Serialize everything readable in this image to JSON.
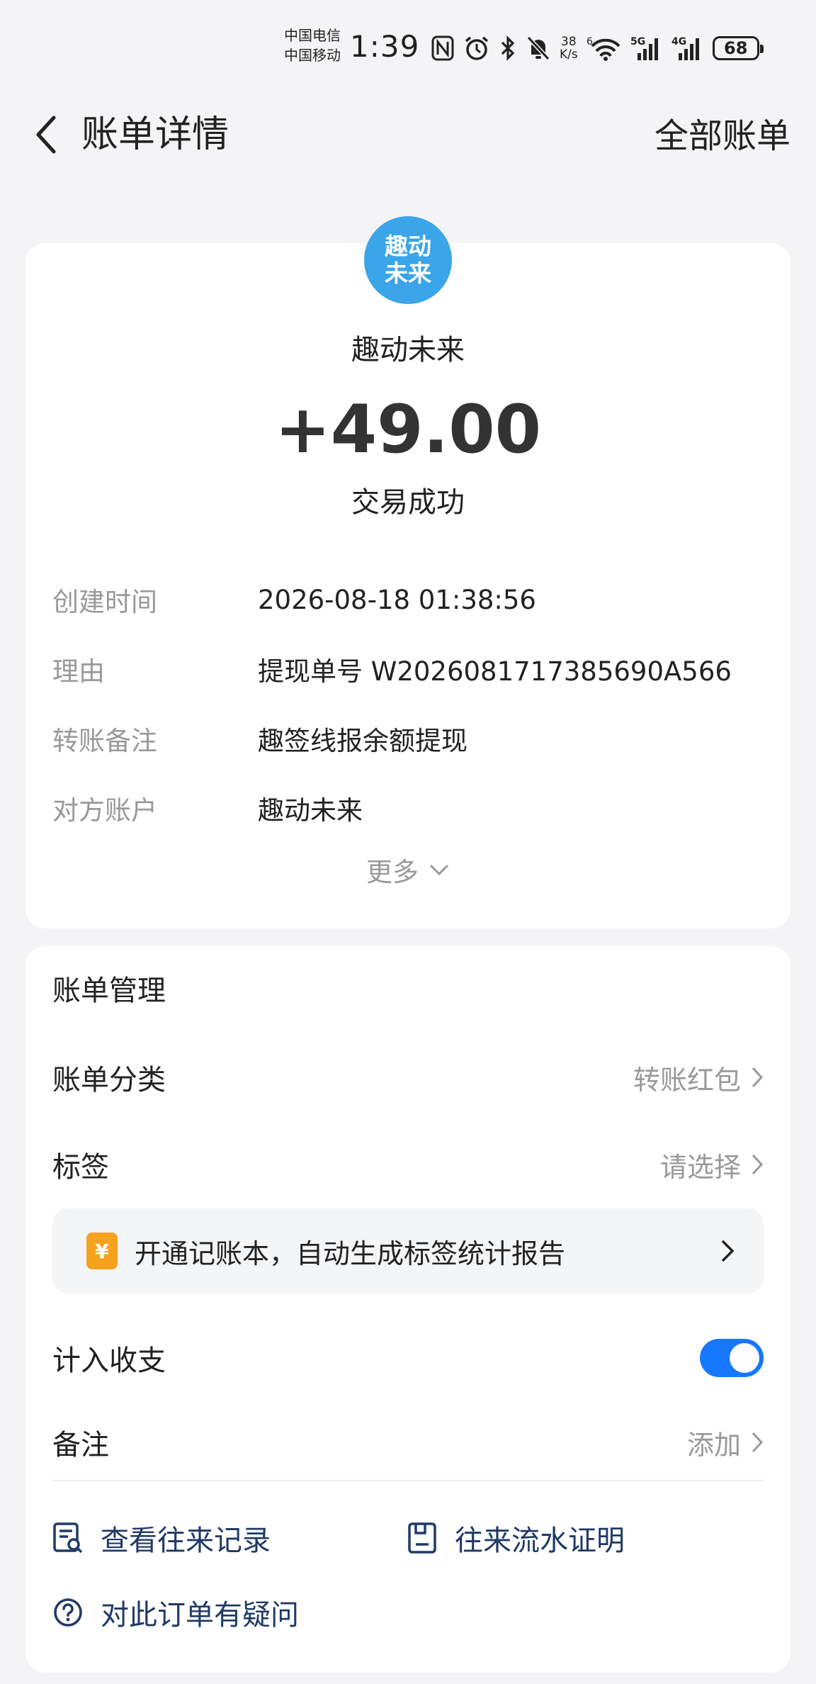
{
  "status_bar": {
    "carrier1": "中国电信",
    "carrier2": "中国移动",
    "time": "1:39",
    "net_speed_value": "38",
    "net_speed_unit": "K/s",
    "wifi_label": "6",
    "signal1_label": "5G",
    "signal2_label": "4G",
    "battery": "68"
  },
  "nav": {
    "title": "账单详情",
    "right_link": "全部账单"
  },
  "summary": {
    "avatar_line1": "趣动",
    "avatar_line2": "未来",
    "merchant": "趣动未来",
    "amount": "+49.00",
    "status": "交易成功",
    "details": [
      {
        "label": "创建时间",
        "value": "2026-08-18 01:38:56"
      },
      {
        "label": "理由",
        "value": "提现单号 W2026081717385690A566"
      },
      {
        "label": "转账备注",
        "value": "趣签线报余额提现"
      },
      {
        "label": "对方账户",
        "value": "趣动未来"
      }
    ],
    "more": "更多"
  },
  "manage": {
    "title": "账单管理",
    "category_label": "账单分类",
    "category_value": "转账红包",
    "tag_label": "标签",
    "tag_value": "请选择",
    "promo_icon": "¥",
    "promo_text": "开通记账本，自动生成标签统计报告",
    "include_label": "计入收支",
    "include_on": true,
    "note_label": "备注",
    "note_value": "添加",
    "links": {
      "history": "查看往来记录",
      "proof": "往来流水证明",
      "question": "对此订单有疑问"
    }
  },
  "colors": {
    "accent_blue": "#1677ff",
    "link_navy": "#1f3a66",
    "avatar_blue": "#3aa5e8",
    "promo_orange": "#f6a21e"
  }
}
